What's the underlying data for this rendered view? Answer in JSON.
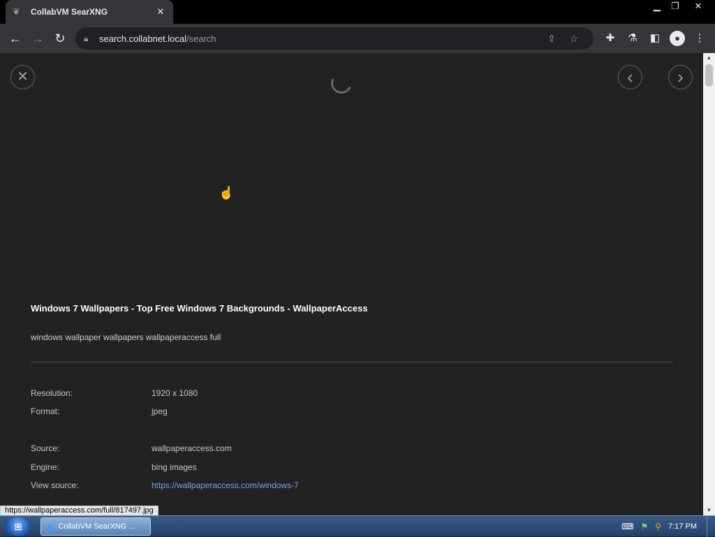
{
  "browser": {
    "tab_title": "CollabVM SearXNG",
    "tab_close": "✕",
    "url_host": "search.collabnet.local",
    "url_path": "/search"
  },
  "viewer": {
    "title": "Windows 7 Wallpapers - Top Free Windows 7 Backgrounds - WallpaperAccess",
    "description": "windows wallpaper wallpapers wallpaperaccess full",
    "details": [
      {
        "label": "Resolution:",
        "value": "1920 x 1080"
      },
      {
        "label": "Format:",
        "value": "jpeg"
      },
      {
        "label": "Source:",
        "value": "wallpaperaccess.com"
      },
      {
        "label": "Engine:",
        "value": "bing images"
      },
      {
        "label": "View source:",
        "value": "https://wallpaperaccess.com/windows-7"
      }
    ]
  },
  "status_url": "https://wallpaperaccess.com/full/817497.jpg",
  "taskbar": {
    "item_label": "CollabVM SearXNG ...",
    "clock": "7:17 PM"
  },
  "icons": {
    "close": "✕",
    "prev": "‹",
    "next": "›"
  }
}
